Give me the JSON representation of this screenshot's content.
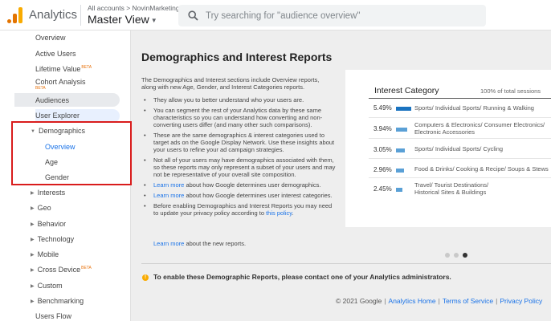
{
  "header": {
    "app_name": "Analytics",
    "breadcrumb": "All accounts > NovinMarketing",
    "view_name": "Master View",
    "search_placeholder": "Try searching for \"audience overview\""
  },
  "sidebar": {
    "items": [
      {
        "label": "Overview"
      },
      {
        "label": "Active Users"
      },
      {
        "label": "Lifetime Value",
        "badge": "BETA"
      },
      {
        "label": "Cohort Analysis",
        "badge": "BETA"
      },
      {
        "label": "Audiences"
      },
      {
        "label": "User Explorer"
      },
      {
        "label": "Demographics",
        "expanded": true
      },
      {
        "label": "Overview",
        "selected": true
      },
      {
        "label": "Age"
      },
      {
        "label": "Gender"
      },
      {
        "label": "Interests"
      },
      {
        "label": "Geo"
      },
      {
        "label": "Behavior"
      },
      {
        "label": "Technology"
      },
      {
        "label": "Mobile"
      },
      {
        "label": "Cross Device",
        "badge": "BETA"
      },
      {
        "label": "Custom"
      },
      {
        "label": "Benchmarking"
      },
      {
        "label": "Users Flow"
      }
    ]
  },
  "main": {
    "title": "Demographics and Interest Reports",
    "intro": "The Demographics and Interest sections include Overview reports, along with new Age, Gender, and Interest Categories reports.",
    "bullets": [
      {
        "text": "They allow you to better understand who your users are."
      },
      {
        "text": "You can segment the rest of your Analytics data by these same characteristics so you can understand how converting and non-converting users differ (and many other such comparisons)."
      },
      {
        "text": "These are the same demographics & interest categories used to target ads on the Google Display Network. Use these insights about your users to refine your ad campaign strategies."
      },
      {
        "text": "Not all of your users may have demographics associated with them, so these reports may only represent a subset of your users and may not be representative of your overall site composition."
      },
      {
        "link": "Learn more",
        "text": " about how Google determines user demographics."
      },
      {
        "link": "Learn more",
        "text": " about how Google determines user interest categories."
      },
      {
        "text": "Before enabling Demographics and Interest Reports you may need to update your privacy policy according to ",
        "link": "this policy",
        "suffix": "."
      }
    ],
    "more_link": "Learn more",
    "more_text": " about the new reports.",
    "notice": "To enable these Demographic Reports, please contact one of your Analytics administrators.",
    "footer": {
      "copyright": "© 2021 Google",
      "links": [
        "Analytics Home",
        "Terms of Service",
        "Privacy Policy"
      ]
    }
  },
  "card": {
    "title": "Interest Category",
    "subtitle": "100% of total sessions",
    "rows": [
      {
        "pct": "5.49%",
        "share": 5.49,
        "lines": [
          "Sports/ Individual Sports/ Running & Walking"
        ]
      },
      {
        "pct": "3.94%",
        "share": 3.94,
        "lines": [
          "Computers & Electronics/ Consumer Electronics/",
          "Electronic Accessories"
        ]
      },
      {
        "pct": "3.05%",
        "share": 3.05,
        "lines": [
          "Sports/ Individual Sports/ Cycling"
        ]
      },
      {
        "pct": "2.96%",
        "share": 2.96,
        "lines": [
          "Food & Drinks/ Cooking & Recipe/ Soups & Stews"
        ]
      },
      {
        "pct": "2.45%",
        "share": 2.45,
        "lines": [
          "Travel/ Tourist Destinations/",
          "Historical Sites & Buildings"
        ]
      }
    ],
    "pager": {
      "count": 3,
      "active": 3
    }
  },
  "colors": {
    "accent": "#1a73e8",
    "bar": "#5aa0d6",
    "highlight_box": "#d91c1c",
    "beta": "#e8710a"
  }
}
